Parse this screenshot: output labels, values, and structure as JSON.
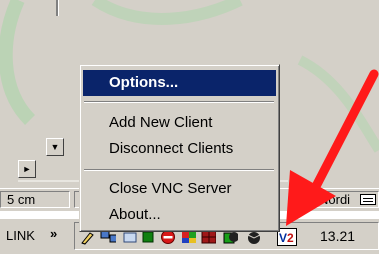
{
  "menu": {
    "items": [
      {
        "label": "Options...",
        "selected": true
      },
      {
        "label": "Add New Client",
        "selected": false
      },
      {
        "label": "Disconnect Clients",
        "selected": false
      },
      {
        "label": "Close VNC Server",
        "selected": false
      },
      {
        "label": "About...",
        "selected": false
      }
    ]
  },
  "statusbar": {
    "measure": "5 cm",
    "right_text": "Nordi"
  },
  "taskbar": {
    "link_label": "LINK",
    "chevron": "»",
    "clock": "13.21",
    "tray_icons": [
      "pen-icon",
      "network-icon",
      "green-square-icon",
      "no-entry-icon",
      "flag-icon",
      "grid-icon",
      "clock-tray-icon",
      "vnc-icon"
    ]
  },
  "scroll": {
    "down_glyph": "▼",
    "right_glyph": "►"
  },
  "colors": {
    "menu_highlight": "#0a246a",
    "arrow": "#ff1a1a",
    "face": "#d4d0c8"
  }
}
